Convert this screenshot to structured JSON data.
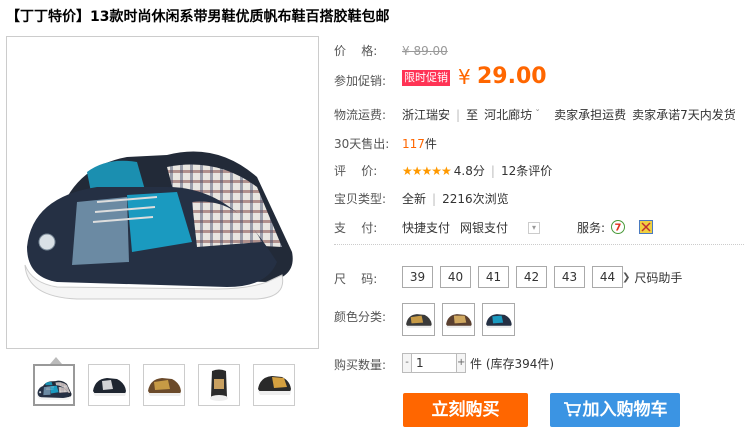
{
  "product": {
    "title": "【丁丁特价】13款时尚休闲系带男鞋优质帆布鞋百搭胶鞋包邮"
  },
  "price": {
    "label": "价    格:",
    "original": "¥ 89.00"
  },
  "promo": {
    "label": "参加促销:",
    "badge": "限时促销",
    "yen": "¥",
    "price": "29.00"
  },
  "shipping": {
    "label": "物流运费:",
    "from": "浙江瑞安",
    "to_prefix": "至",
    "to": "河北廊坊",
    "arrow": "ˇ",
    "fee": "卖家承担运费",
    "promise": "卖家承诺7天内发货"
  },
  "sold": {
    "label": "30天售出:",
    "count": "117",
    "unit": "件"
  },
  "rating": {
    "label": "评    价:",
    "stars": "★★★★★",
    "score": "4.8分",
    "reviews": "12条评价"
  },
  "item_type": {
    "label": "宝贝类型:",
    "condition": "全新",
    "views": "2216次浏览"
  },
  "payment": {
    "label": "支    付:",
    "method1": "快捷支付",
    "method2": "网银支付",
    "service_label": "服务:"
  },
  "size": {
    "label": "尺    码:",
    "options": [
      "39",
      "40",
      "41",
      "42",
      "43",
      "44"
    ],
    "help": "尺码助手"
  },
  "color": {
    "label": "颜色分类:"
  },
  "quantity": {
    "label": "购买数量:",
    "minus": "-",
    "value": "1",
    "plus": "+",
    "stock": "件 (库存394件)"
  },
  "actions": {
    "buy": "立刻购买",
    "cart": "加入购物车"
  },
  "colors": {
    "accent": "#ff6600",
    "cart": "#3b94e3",
    "promo_badge": "#ff3355"
  }
}
